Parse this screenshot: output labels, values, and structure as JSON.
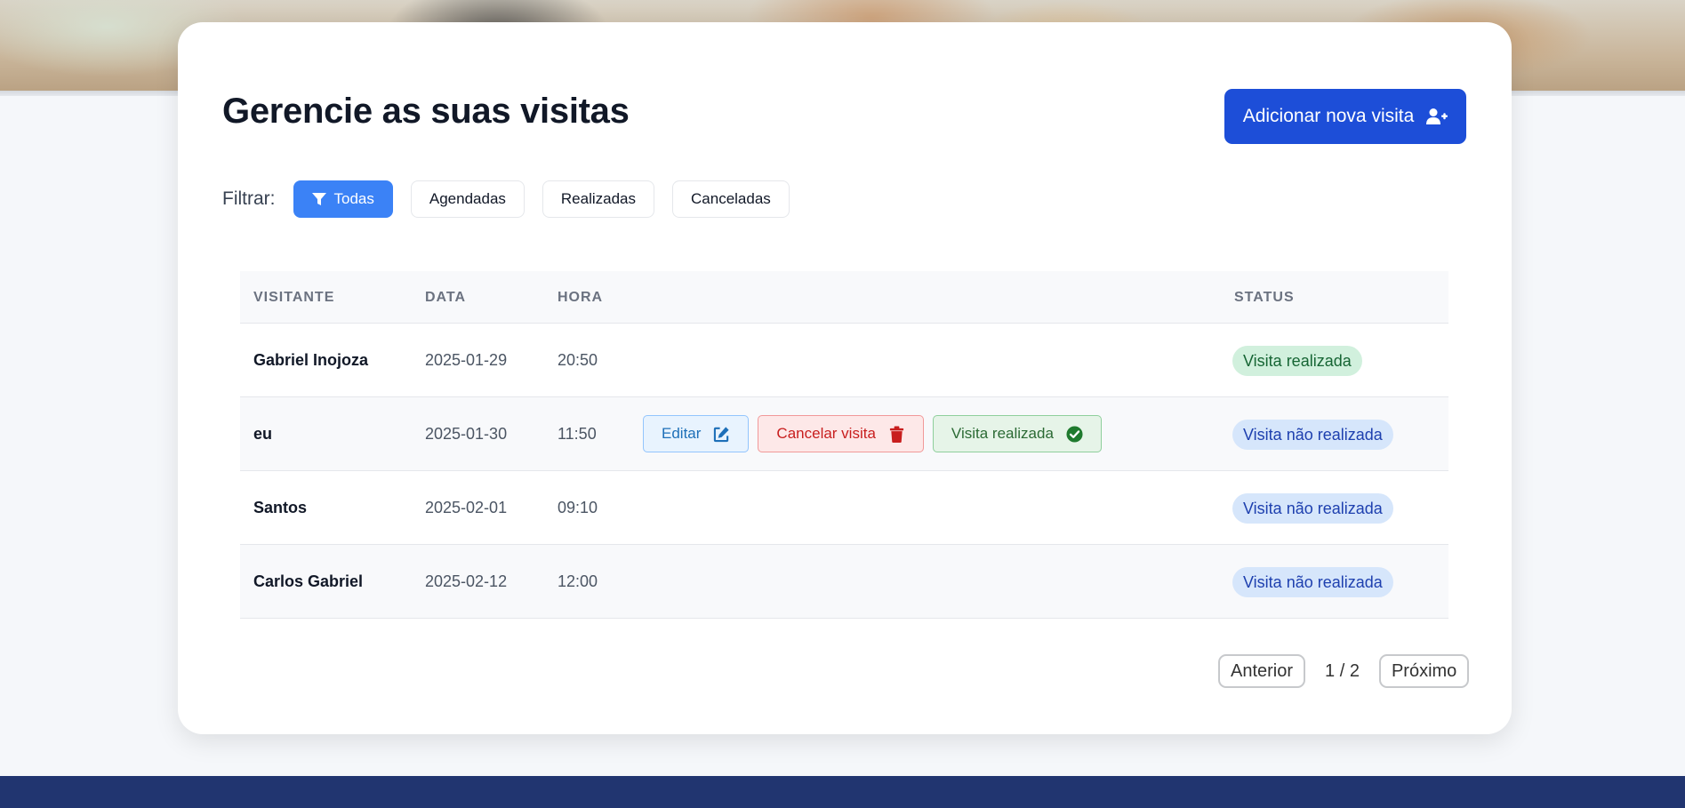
{
  "header": {
    "title": "Gerencie as suas visitas",
    "add_button_label": "Adicionar nova visita"
  },
  "filters": {
    "label": "Filtrar:",
    "options": [
      "Todas",
      "Agendadas",
      "Realizadas",
      "Canceladas"
    ],
    "active": "Todas"
  },
  "table": {
    "columns": [
      "VISITANTE",
      "DATA",
      "HORA",
      "STATUS"
    ],
    "rows": [
      {
        "visitante": "Gabriel Inojoza",
        "data": "2025-01-29",
        "hora": "20:50",
        "status": "Visita realizada"
      },
      {
        "visitante": "eu",
        "data": "2025-01-30",
        "hora": "11:50",
        "status": "Visita não realizada"
      },
      {
        "visitante": "Santos",
        "data": "2025-02-01",
        "hora": "09:10",
        "status": "Visita não realizada"
      },
      {
        "visitante": "Carlos Gabriel",
        "data": "2025-02-12",
        "hora": "12:00",
        "status": "Visita não realizada"
      }
    ],
    "row_actions": {
      "edit": "Editar",
      "cancel": "Cancelar visita",
      "done": "Visita realizada"
    }
  },
  "pagination": {
    "previous": "Anterior",
    "indicator": "1 / 2",
    "next": "Próximo"
  },
  "icons": {
    "add": "user-plus-icon",
    "filter": "filter-icon",
    "edit": "edit-icon",
    "delete": "trash-icon",
    "check": "check-circle-icon"
  },
  "colors": {
    "primary": "#1d4ed8",
    "filter_active": "#3b82f6",
    "footer": "#213570",
    "status_done_bg": "#d1f0dd",
    "status_pending_bg": "#d6e6fb"
  }
}
